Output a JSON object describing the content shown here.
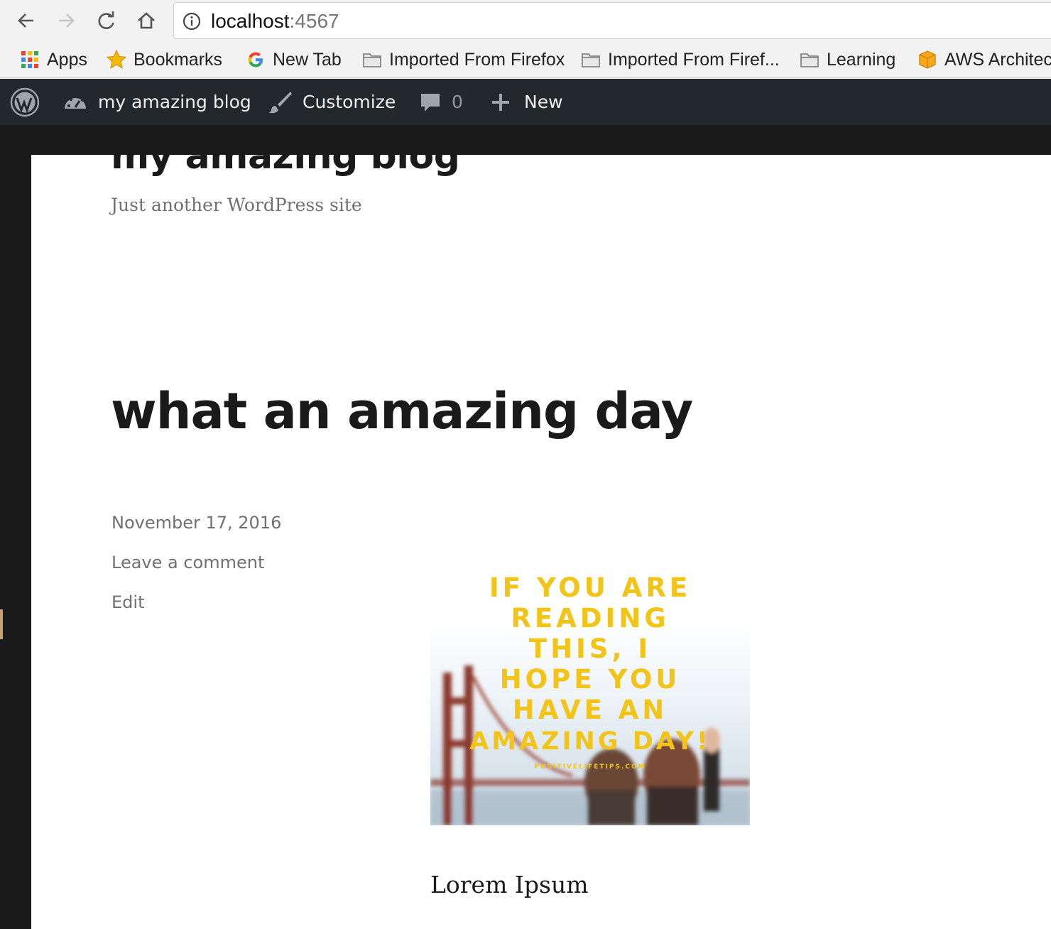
{
  "browser": {
    "url_host": "localhost",
    "url_port": ":4567"
  },
  "bookmarks": [
    {
      "label": "Apps",
      "icon": "apps-grid-icon"
    },
    {
      "label": "Bookmarks",
      "icon": "star-icon"
    },
    {
      "label": "New Tab",
      "icon": "google-icon"
    },
    {
      "label": "Imported From Firefox",
      "icon": "folder-icon"
    },
    {
      "label": "Imported From Firef...",
      "icon": "folder-icon"
    },
    {
      "label": "Learning",
      "icon": "folder-icon"
    },
    {
      "label": "AWS Architec",
      "icon": "aws-box-icon"
    }
  ],
  "adminbar": {
    "site_name": "my amazing blog",
    "customize": "Customize",
    "comments_count": "0",
    "new": "New"
  },
  "site": {
    "title": "my amazing blog",
    "description": "Just another WordPress site"
  },
  "post": {
    "title": "what an amazing day",
    "date": "November 17, 2016",
    "comment_link": "Leave a comment",
    "edit_link": "Edit",
    "image_text": [
      "IF YOU ARE",
      "READING",
      "THIS, I",
      "HOPE YOU",
      "HAVE AN",
      "AMAZING DAY!"
    ],
    "image_watermark": "POSITIVELIFETIPS.COM",
    "body_text": "Lorem Ipsum"
  },
  "colors": {
    "adminbar_bg": "#23282d",
    "page_dark_bg": "#1a1a1a",
    "meta_text": "#707070",
    "image_text_yellow": "#f2c417"
  }
}
